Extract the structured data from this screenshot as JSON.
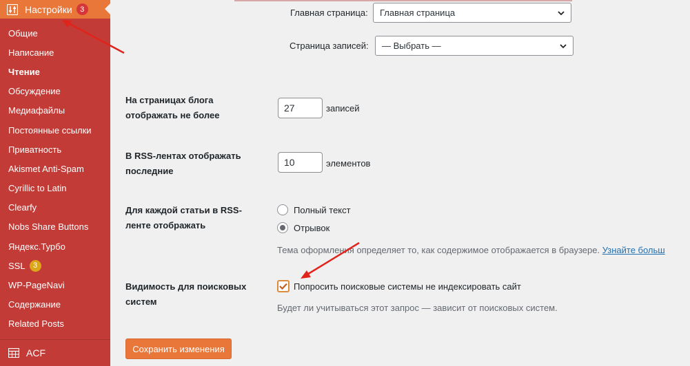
{
  "sidebar": {
    "header": {
      "title": "Настройки",
      "badge": "3",
      "icon": "sliders-icon"
    },
    "items": [
      {
        "label": "Общие"
      },
      {
        "label": "Написание"
      },
      {
        "label": "Чтение"
      },
      {
        "label": "Обсуждение"
      },
      {
        "label": "Медиафайлы"
      },
      {
        "label": "Постоянные ссылки"
      },
      {
        "label": "Приватность"
      },
      {
        "label": "Akismet Anti-Spam"
      },
      {
        "label": "Cyrillic to Latin"
      },
      {
        "label": "Clearfy"
      },
      {
        "label": "Nobs Share Buttons"
      },
      {
        "label": "Яндекс.Турбо"
      },
      {
        "label": "SSL",
        "badge": "3"
      },
      {
        "label": "WP-PageNavi"
      },
      {
        "label": "Содержание"
      },
      {
        "label": "Related Posts"
      }
    ],
    "current": "Чтение",
    "acf": {
      "label": "ACF",
      "icon": "grid-table-icon"
    }
  },
  "form": {
    "front_page": {
      "label": "Главная страница:",
      "value": "Главная страница"
    },
    "posts_page": {
      "label": "Страница записей:",
      "value": "— Выбрать —"
    },
    "posts_per_page": {
      "label_line1": "На страницах блога",
      "label_line2": "отображать не более",
      "value": "27",
      "suffix": "записей"
    },
    "rss_count": {
      "label_line1": "В RSS-лентах отображать",
      "label_line2": "последние",
      "value": "10",
      "suffix": "элементов"
    },
    "rss_content": {
      "label_line1": "Для каждой статьи в RSS-",
      "label_line2": "ленте отображать",
      "options": [
        {
          "label": "Полный текст",
          "checked": false
        },
        {
          "label": "Отрывок",
          "checked": true
        }
      ],
      "description": "Тема оформления определяет то, как содержимое отображается в браузере.",
      "link": "Узнайте больш"
    },
    "search_visibility": {
      "label_line1": "Видимость для поисковых",
      "label_line2": "систем",
      "checkbox_label": "Попросить поисковые системы не индексировать сайт",
      "checked": true,
      "description": "Будет ли учитываться этот запрос — зависит от поисковых систем."
    },
    "save_button": "Сохранить изменения"
  },
  "colors": {
    "sidebar": "#c33b36",
    "accent": "#e9773a",
    "annotation_arrow": "#e0241c"
  }
}
